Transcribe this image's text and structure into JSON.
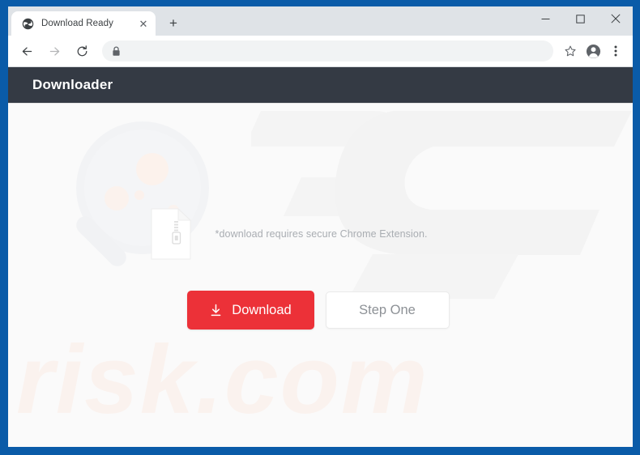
{
  "browser": {
    "tab": {
      "title": "Download Ready",
      "favicon": "globe-icon",
      "close_label": "✕"
    },
    "new_tab_label": "+",
    "window_controls": {
      "minimize": "minimize-icon",
      "maximize": "maximize-icon",
      "close": "close-icon"
    },
    "toolbar": {
      "back": "back-arrow-icon",
      "forward": "forward-arrow-icon",
      "reload": "reload-icon",
      "lock": "lock-icon",
      "url": "",
      "url_placeholder": "",
      "bookmark": "star-icon",
      "profile": "profile-avatar-icon",
      "menu": "three-dot-menu-icon"
    }
  },
  "page": {
    "header": {
      "title": "Downloader"
    },
    "file": {
      "icon": "zip-file-icon",
      "note": "*download requires secure Chrome Extension."
    },
    "actions": {
      "download_label": "Download",
      "download_icon": "download-arrow-icon",
      "step_label": "Step One"
    },
    "watermarks": {
      "logo": "PC",
      "domain": "risk.com",
      "magnifier": "magnifying-glass-watermark"
    },
    "colors": {
      "frame_blue": "#0a5ba8",
      "header_dark": "#343a44",
      "accent_red": "#ec3138",
      "page_background": "#fafafa",
      "watermark_cream": "#faf2ee",
      "note_gray": "#a9adb2"
    }
  }
}
